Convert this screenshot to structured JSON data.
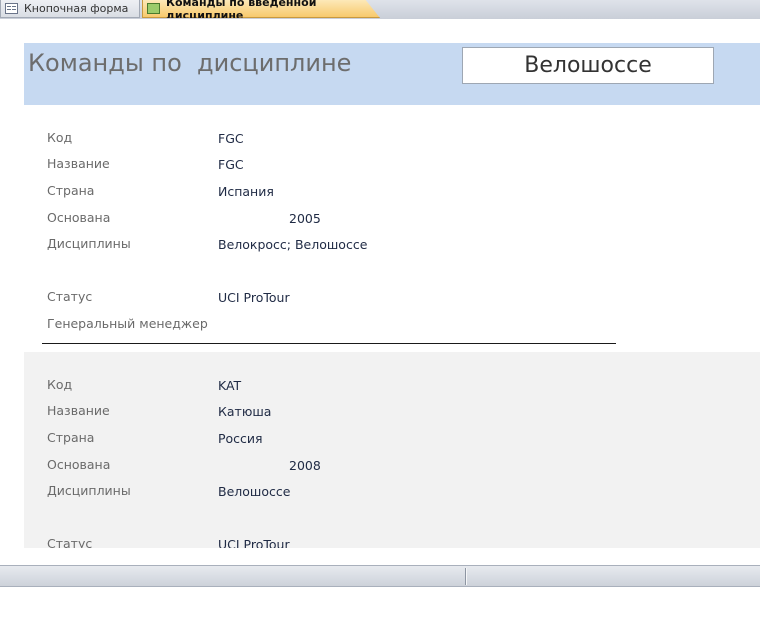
{
  "tabs": [
    {
      "label": "Кнопочная форма",
      "icon": "form-icon",
      "active": false
    },
    {
      "label": "Команды по введённой дисциплине",
      "icon": "report-icon",
      "active": true
    }
  ],
  "report": {
    "title": "Команды по  дисциплине",
    "discipline": "Велошоссе"
  },
  "labels": {
    "code": "Код",
    "name": "Название",
    "country": "Страна",
    "founded": "Основана",
    "disciplines": "Дисциплины",
    "status": "Статус",
    "manager": "Генеральный менеджер"
  },
  "records": [
    {
      "code": "FGC",
      "name": "FGC",
      "country": "Испания",
      "founded": "2005",
      "disciplines": "Велокросс; Велошоссе",
      "status": "UCI ProTour",
      "manager": ""
    },
    {
      "code": "KAT",
      "name": "Катюша",
      "country": "Россия",
      "founded": "2008",
      "disciplines": "Велошоссе",
      "status": "UCI ProTour"
    }
  ],
  "colors": {
    "header_band": "#c6d9f1",
    "active_tab": "#f7c96d",
    "alt_record": "#f2f2f2"
  }
}
